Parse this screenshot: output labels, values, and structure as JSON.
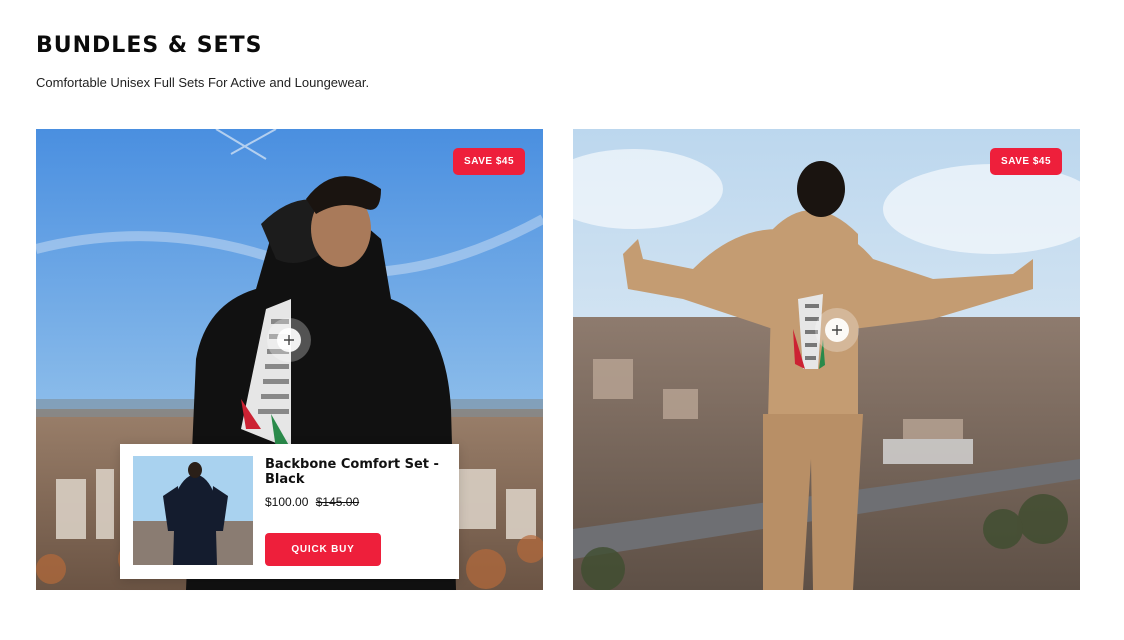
{
  "section": {
    "title": "BUNDLES & SETS",
    "subtitle": "Comfortable Unisex Full Sets For Active and Loungewear."
  },
  "products": [
    {
      "badge": "SAVE $45",
      "hoodie_color": "#111111"
    },
    {
      "badge": "SAVE $45",
      "hoodie_color": "#c49c72"
    }
  ],
  "popup": {
    "name": "Backbone Comfort Set - Black",
    "price": "$100.00",
    "compare_price": "$145.00",
    "button": "QUICK BUY"
  },
  "colors": {
    "accent": "#ee1f3b"
  },
  "icons": {
    "hotspot": "plus-icon"
  }
}
